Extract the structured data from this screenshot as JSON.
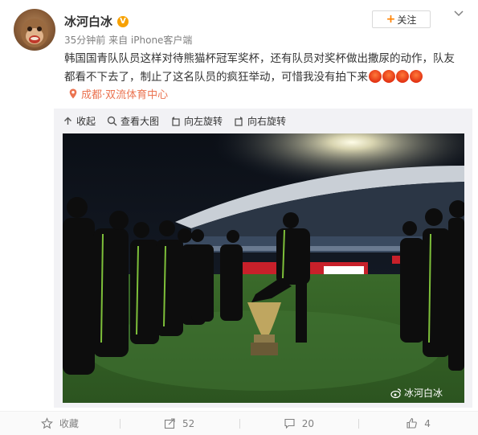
{
  "post": {
    "username": "冰河白冰",
    "verified_badge": "V",
    "time": "35分钟前",
    "source": "来自 iPhone客户端",
    "follow_label": "关注",
    "text": "韩国国青队队员这样对待熊猫杯冠军奖杯，还有队员对奖杯做出撒尿的动作，队友都看不下去了，制止了这名队员的疯狂举动，可惜我没有拍下来",
    "emoji_count": 4,
    "location": "成都·双流体育中心"
  },
  "toolbar": {
    "collapse": "收起",
    "view_large": "查看大图",
    "rotate_left": "向左旋转",
    "rotate_right": "向右旋转"
  },
  "photo": {
    "watermark": "冰河白冰"
  },
  "actions": {
    "favorite_label": "收藏",
    "repost_count": "52",
    "comment_count": "20",
    "like_count": "4"
  },
  "colors": {
    "accent_orange": "#ff8200",
    "location": "#eb7350",
    "verified": "#f7a100"
  }
}
